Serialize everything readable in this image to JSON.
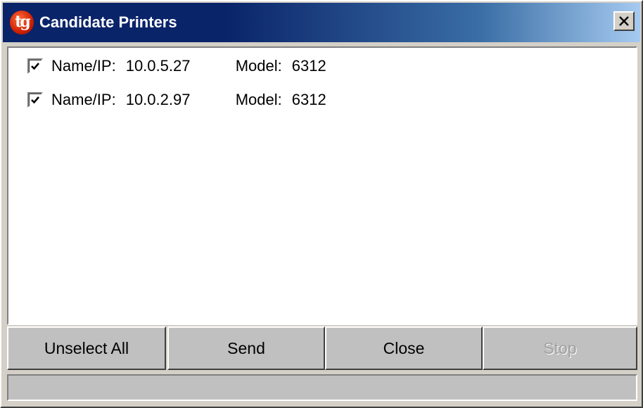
{
  "window": {
    "title": "Candidate Printers",
    "app_icon_text": "tg",
    "app_icon": "tg-app-icon",
    "close_icon": "close-x-icon"
  },
  "printers": [
    {
      "checked": true,
      "name_label": "Name/IP:",
      "name_value": "10.0.5.27",
      "model_label": "Model:",
      "model_value": "6312"
    },
    {
      "checked": true,
      "name_label": "Name/IP:",
      "name_value": "10.0.2.97",
      "model_label": "Model:",
      "model_value": "6312"
    }
  ],
  "buttons": {
    "unselect_all": "Unselect All",
    "send": "Send",
    "close": "Close",
    "stop": "Stop",
    "stop_disabled": true
  },
  "status_bar": {
    "text": ""
  },
  "colors": {
    "titlebar_start": "#0a246a",
    "titlebar_end": "#a6caf0",
    "face": "#d4d0c8",
    "disabled_text": "#a0a0a0"
  }
}
